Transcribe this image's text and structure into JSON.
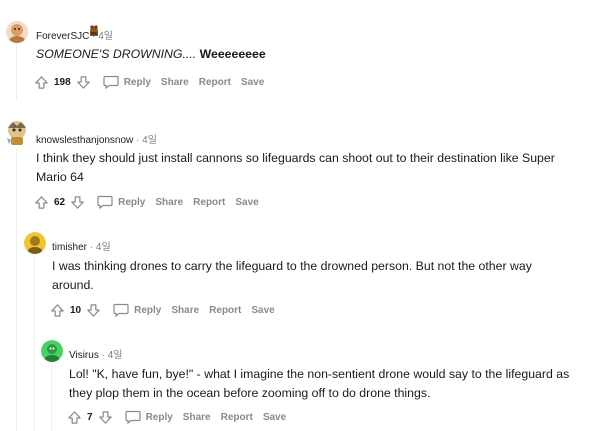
{
  "comments": [
    {
      "username": "ForeverSJC",
      "age": "4일",
      "body_italic": "SOMEONE'S DROWNING....",
      "body_bold": "Weeeeeeee",
      "score": "198",
      "actions": {
        "reply": "Reply",
        "share": "Share",
        "report": "Report",
        "save": "Save"
      }
    },
    {
      "username": "knowslesthanjonsnow",
      "age": "4일",
      "body": "I think they should just install cannons so lifeguards can shoot out to their destination like Super Mario 64",
      "score": "62",
      "actions": {
        "reply": "Reply",
        "share": "Share",
        "report": "Report",
        "save": "Save"
      }
    },
    {
      "username": "timisher",
      "age": "4일",
      "body": "I was thinking drones to carry the lifeguard to the drowned person. But not the other way around.",
      "score": "10",
      "actions": {
        "reply": "Reply",
        "share": "Share",
        "report": "Report",
        "save": "Save"
      }
    },
    {
      "username": "Visirus",
      "age": "4일",
      "body": "Lol! \"K, have fun, bye!\" - what I imagine the non-sentient drone would say to the lifeguard as they plop them in the ocean before zooming off to do drone things.",
      "score": "7",
      "actions": {
        "reply": "Reply",
        "share": "Share",
        "report": "Report",
        "save": "Save"
      }
    }
  ],
  "colors": {
    "avatar_1": "#d9a066",
    "avatar_2": "#c58b3a",
    "avatar_3": "#f4c430",
    "avatar_4": "#46d160",
    "thread_line": "#edeff1",
    "meta_text": "#7c7c7c"
  }
}
